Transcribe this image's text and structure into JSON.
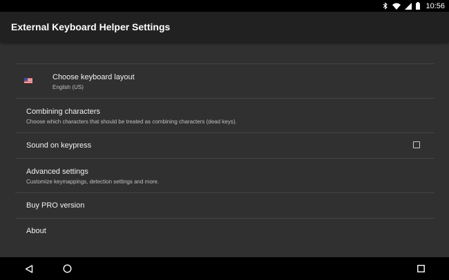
{
  "status_bar": {
    "time": "10:56",
    "icons": [
      "bluetooth-icon",
      "wifi-icon",
      "signal-icon",
      "battery-icon"
    ]
  },
  "app_bar": {
    "title": "External Keyboard Helper Settings"
  },
  "settings": [
    {
      "title": "Choose keyboard layout",
      "summary": "English (US)",
      "icon": "us-flag-icon"
    },
    {
      "title": "Combining characters",
      "summary": "Choose which characters that should be treated as combining characters (dead keys)."
    },
    {
      "title": "Sound on keypress",
      "checked": false
    },
    {
      "title": "Advanced settings",
      "summary": "Customize keymappings, detection settings and more."
    },
    {
      "title": "Buy PRO version"
    },
    {
      "title": "About"
    }
  ],
  "nav_bar": {
    "icons": [
      "back-icon",
      "home-icon",
      "recents-icon"
    ]
  },
  "colors": {
    "background": "#303030",
    "app_bar": "#212121",
    "divider": "#444444",
    "text_primary": "#f2f2f2",
    "text_secondary": "#c0c0c0"
  }
}
